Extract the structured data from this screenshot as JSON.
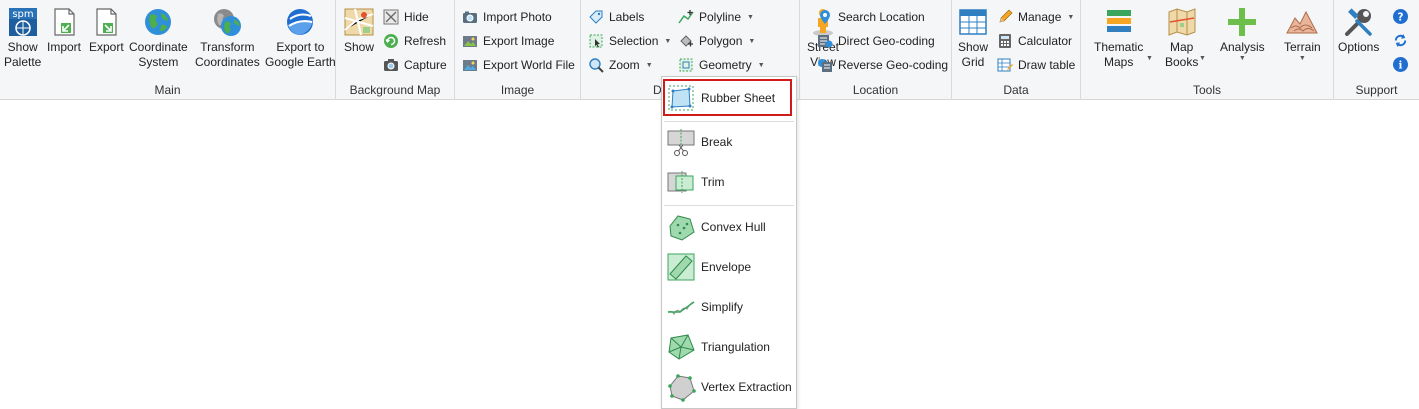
{
  "colors": {
    "accent_highlight": "#d11a1a",
    "ribbon_bg": "#f5f6f7",
    "geometry_green": "#3aa55c"
  },
  "ribbon": {
    "main": {
      "label": "Main",
      "show_palette": [
        "Show",
        "Palette"
      ],
      "import": "Import",
      "export": "Export",
      "coordinate_system": [
        "Coordinate",
        "System"
      ],
      "transform_coordinates": [
        "Transform",
        "Coordinates"
      ],
      "export_google_earth": [
        "Export to",
        "Google Earth"
      ]
    },
    "background_map": {
      "label": "Background Map",
      "show": "Show",
      "hide": "Hide",
      "refresh": "Refresh",
      "capture": "Capture"
    },
    "image": {
      "label": "Image",
      "import_photo": "Import Photo",
      "export_image": "Export Image",
      "export_world_file": "Export World File"
    },
    "drawing": {
      "label": "D",
      "labels": "Labels",
      "selection": "Selection",
      "zoom": "Zoom",
      "polyline": "Polyline",
      "polygon": "Polygon",
      "geometry": "Geometry"
    },
    "location": {
      "label": "Location",
      "street_view": [
        "Street",
        "View"
      ],
      "search_location": "Search Location",
      "direct_geocoding": "Direct Geo-coding",
      "reverse_geocoding": "Reverse Geo-coding"
    },
    "data": {
      "label": "Data",
      "show_grid": [
        "Show",
        "Grid"
      ],
      "manage": "Manage",
      "calculator": "Calculator",
      "draw_table": "Draw table"
    },
    "tools": {
      "label": "Tools",
      "thematic_maps": [
        "Thematic",
        "Maps"
      ],
      "map_books": [
        "Map",
        "Books"
      ],
      "analysis": "Analysis",
      "terrain": "Terrain"
    },
    "support": {
      "label": "Support",
      "options": "Options"
    }
  },
  "icons": {
    "spm_logo_text": "spm",
    "info_glyph": "i",
    "question_glyph": "?"
  },
  "geometry_menu": {
    "items": [
      "Rubber Sheet",
      "Break",
      "Trim",
      "Convex Hull",
      "Envelope",
      "Simplify",
      "Triangulation",
      "Vertex Extraction"
    ]
  }
}
